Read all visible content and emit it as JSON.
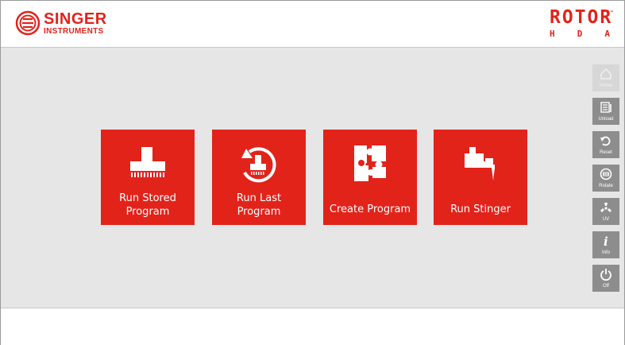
{
  "header": {
    "brand_left_line1": "SINGER",
    "brand_left_line2": "INSTRUMENTS",
    "brand_right_top": "ROTOR",
    "brand_right_tm": "™",
    "brand_right_bottom": [
      "H",
      "D",
      "A"
    ]
  },
  "tiles": [
    {
      "label_line1": "Run Stored",
      "label_line2": "Program",
      "icon": "pin-pad-icon"
    },
    {
      "label_line1": "Run Last",
      "label_line2": "Program",
      "icon": "repeat-pin-pad-icon"
    },
    {
      "label": "Create Program",
      "icon": "puzzle-icon"
    },
    {
      "label": "Run Stinger",
      "icon": "stinger-icon"
    }
  ],
  "sidebar": [
    {
      "label": "Home",
      "icon": "home-icon",
      "enabled": false
    },
    {
      "label": "Unload",
      "icon": "unload-icon",
      "enabled": true
    },
    {
      "label": "Reset",
      "icon": "reset-icon",
      "enabled": true
    },
    {
      "label": "Rotate",
      "icon": "rotate-icon",
      "enabled": true
    },
    {
      "label": "UV",
      "icon": "uv-icon",
      "enabled": true
    },
    {
      "label": "Info",
      "icon": "info-icon",
      "enabled": true
    },
    {
      "label": "Off",
      "icon": "power-icon",
      "enabled": true
    }
  ],
  "colors": {
    "brand_red": "#e2231a",
    "side_button": "#8d8d8d",
    "side_button_disabled": "#d7d7d7",
    "work_area": "#e6e6e6"
  }
}
